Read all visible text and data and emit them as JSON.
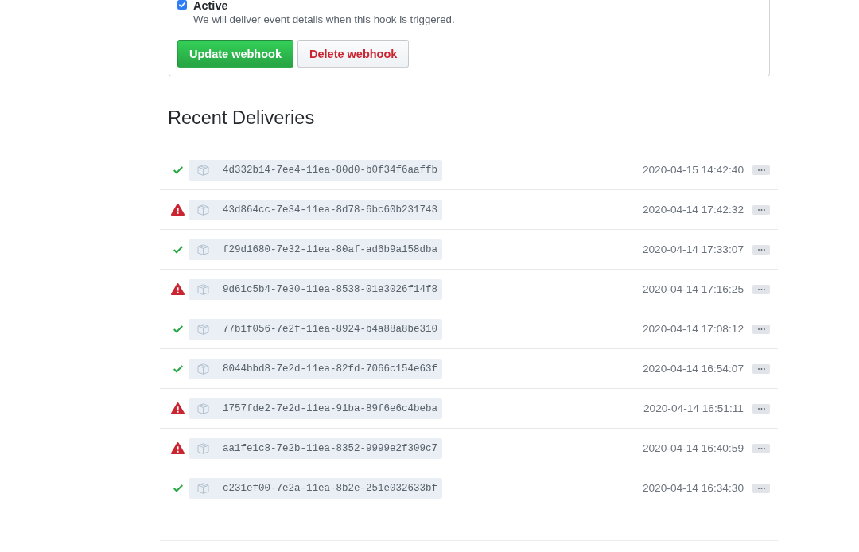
{
  "webhook_form": {
    "active": {
      "label": "Active",
      "checked": true,
      "description": "We will deliver event details when this hook is triggered."
    },
    "buttons": [
      {
        "label": "Update webhook",
        "kind": "primary"
      },
      {
        "label": "Delete webhook",
        "kind": "danger"
      }
    ]
  },
  "recent_deliveries": {
    "title": "Recent Deliveries",
    "items": [
      {
        "succeeded": true,
        "guid": "4d332b14-7ee4-11ea-80d0-b0f34f6aaffb",
        "time": "2020-04-15 14:42:40"
      },
      {
        "succeeded": false,
        "guid": "43d864cc-7e34-11ea-8d78-6bc60b231743",
        "time": "2020-04-14 17:42:32"
      },
      {
        "succeeded": true,
        "guid": "f29d1680-7e32-11ea-80af-ad6b9a158dba",
        "time": "2020-04-14 17:33:07"
      },
      {
        "succeeded": false,
        "guid": "9d61c5b4-7e30-11ea-8538-01e3026f14f8",
        "time": "2020-04-14 17:16:25"
      },
      {
        "succeeded": true,
        "guid": "77b1f056-7e2f-11ea-8924-b4a88a8be310",
        "time": "2020-04-14 17:08:12"
      },
      {
        "succeeded": true,
        "guid": "8044bbd8-7e2d-11ea-82fd-7066c154e63f",
        "time": "2020-04-14 16:54:07"
      },
      {
        "succeeded": false,
        "guid": "1757fde2-7e2d-11ea-91ba-89f6e6c4beba",
        "time": "2020-04-14 16:51:11"
      },
      {
        "succeeded": false,
        "guid": "aa1fe1c8-7e2b-11ea-8352-9999e2f309c7",
        "time": "2020-04-14 16:40:59"
      },
      {
        "succeeded": true,
        "guid": "c231ef00-7e2a-11ea-8b2e-251e032633bf",
        "time": "2020-04-14 16:34:30"
      }
    ]
  }
}
